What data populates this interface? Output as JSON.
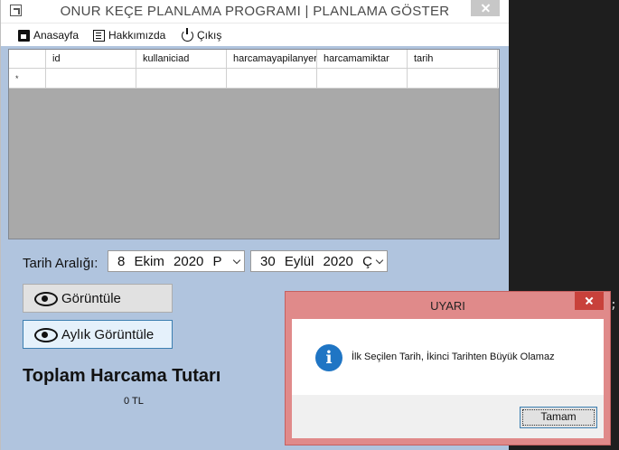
{
  "window": {
    "title": "ONUR KEÇE PLANLAMA PROGRAMI | PLANLAMA GÖSTER"
  },
  "menu": {
    "items": [
      {
        "label": "Anasayfa",
        "icon": "clipboard-icon"
      },
      {
        "label": "Hakkımızda",
        "icon": "book-icon"
      },
      {
        "label": "Çıkış",
        "icon": "power-icon"
      }
    ]
  },
  "grid": {
    "columns": [
      "id",
      "kullaniciad",
      "harcamayapilanyer",
      "harcamamiktar",
      "tarih"
    ],
    "new_row_marker": "*"
  },
  "filter": {
    "label": "Tarih Aralığı:",
    "start_date": "8 Ekim 2020 P",
    "end_date": "30 Eylül 2020 Ç"
  },
  "buttons": {
    "view": "Görüntüle",
    "monthly": "Aylık Görüntüle"
  },
  "total": {
    "title": "Toplam Harcama Tutarı",
    "value": "0 TL"
  },
  "dialog": {
    "title": "UYARI",
    "message": "İlk Seçilen Tarih, İkinci Tarihten Büyük Olamaz",
    "ok_label": "Tamam",
    "icon": "info-icon"
  },
  "background": {
    "code_fragment": ";"
  },
  "colors": {
    "form_bg": "#b0c4de",
    "grid_bg": "#a9a9a9",
    "dialog_frame": "#e08a8a",
    "dialog_close": "#c8413b",
    "info_icon": "#1f75c4"
  }
}
